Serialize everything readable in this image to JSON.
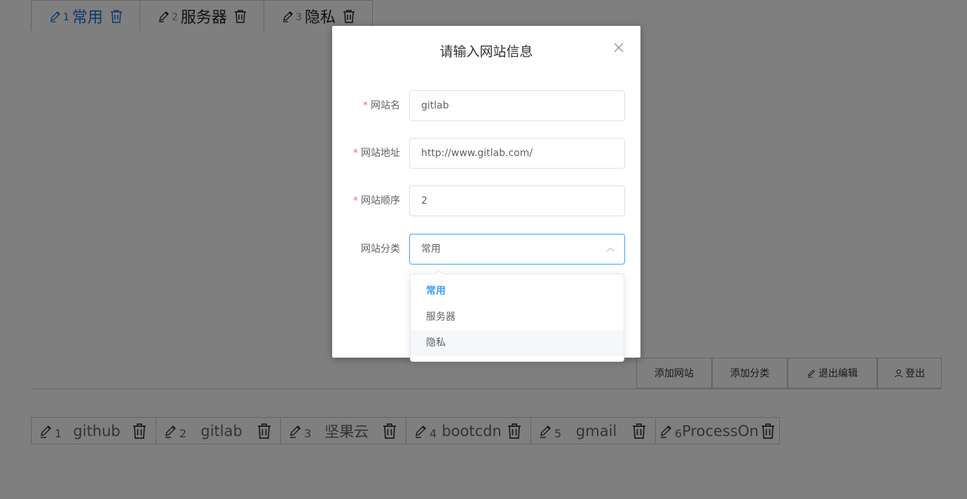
{
  "tabs": [
    {
      "num": "1",
      "label": "常用",
      "active": true
    },
    {
      "num": "2",
      "label": "服务器",
      "active": false
    },
    {
      "num": "3",
      "label": "隐私",
      "active": false
    }
  ],
  "toolbar": {
    "add_site": "添加网站",
    "add_category": "添加分类",
    "exit_edit": "退出编辑",
    "logout": "登出"
  },
  "sites": [
    {
      "num": "1",
      "name": "github"
    },
    {
      "num": "2",
      "name": "gitlab"
    },
    {
      "num": "3",
      "name": "坚果云"
    },
    {
      "num": "4",
      "name": "bootcdn"
    },
    {
      "num": "5",
      "name": "gmail"
    },
    {
      "num": "6",
      "name": "ProcessOn"
    }
  ],
  "dialog": {
    "title": "请输入网站信息",
    "fields": {
      "name": {
        "label": "网站名",
        "required_mark": "*",
        "value": "gitlab"
      },
      "url": {
        "label": "网站地址",
        "required_mark": "*",
        "value": "http://www.gitlab.com/"
      },
      "order": {
        "label": "网站顺序",
        "required_mark": "*",
        "value": "2"
      },
      "category": {
        "label": "网站分类",
        "value": "常用"
      }
    },
    "category_options": [
      "常用",
      "服务器",
      "隐私"
    ]
  },
  "colors": {
    "accent": "#409eff",
    "tab_active": "#1f6fd6",
    "required": "#f56c6c"
  }
}
